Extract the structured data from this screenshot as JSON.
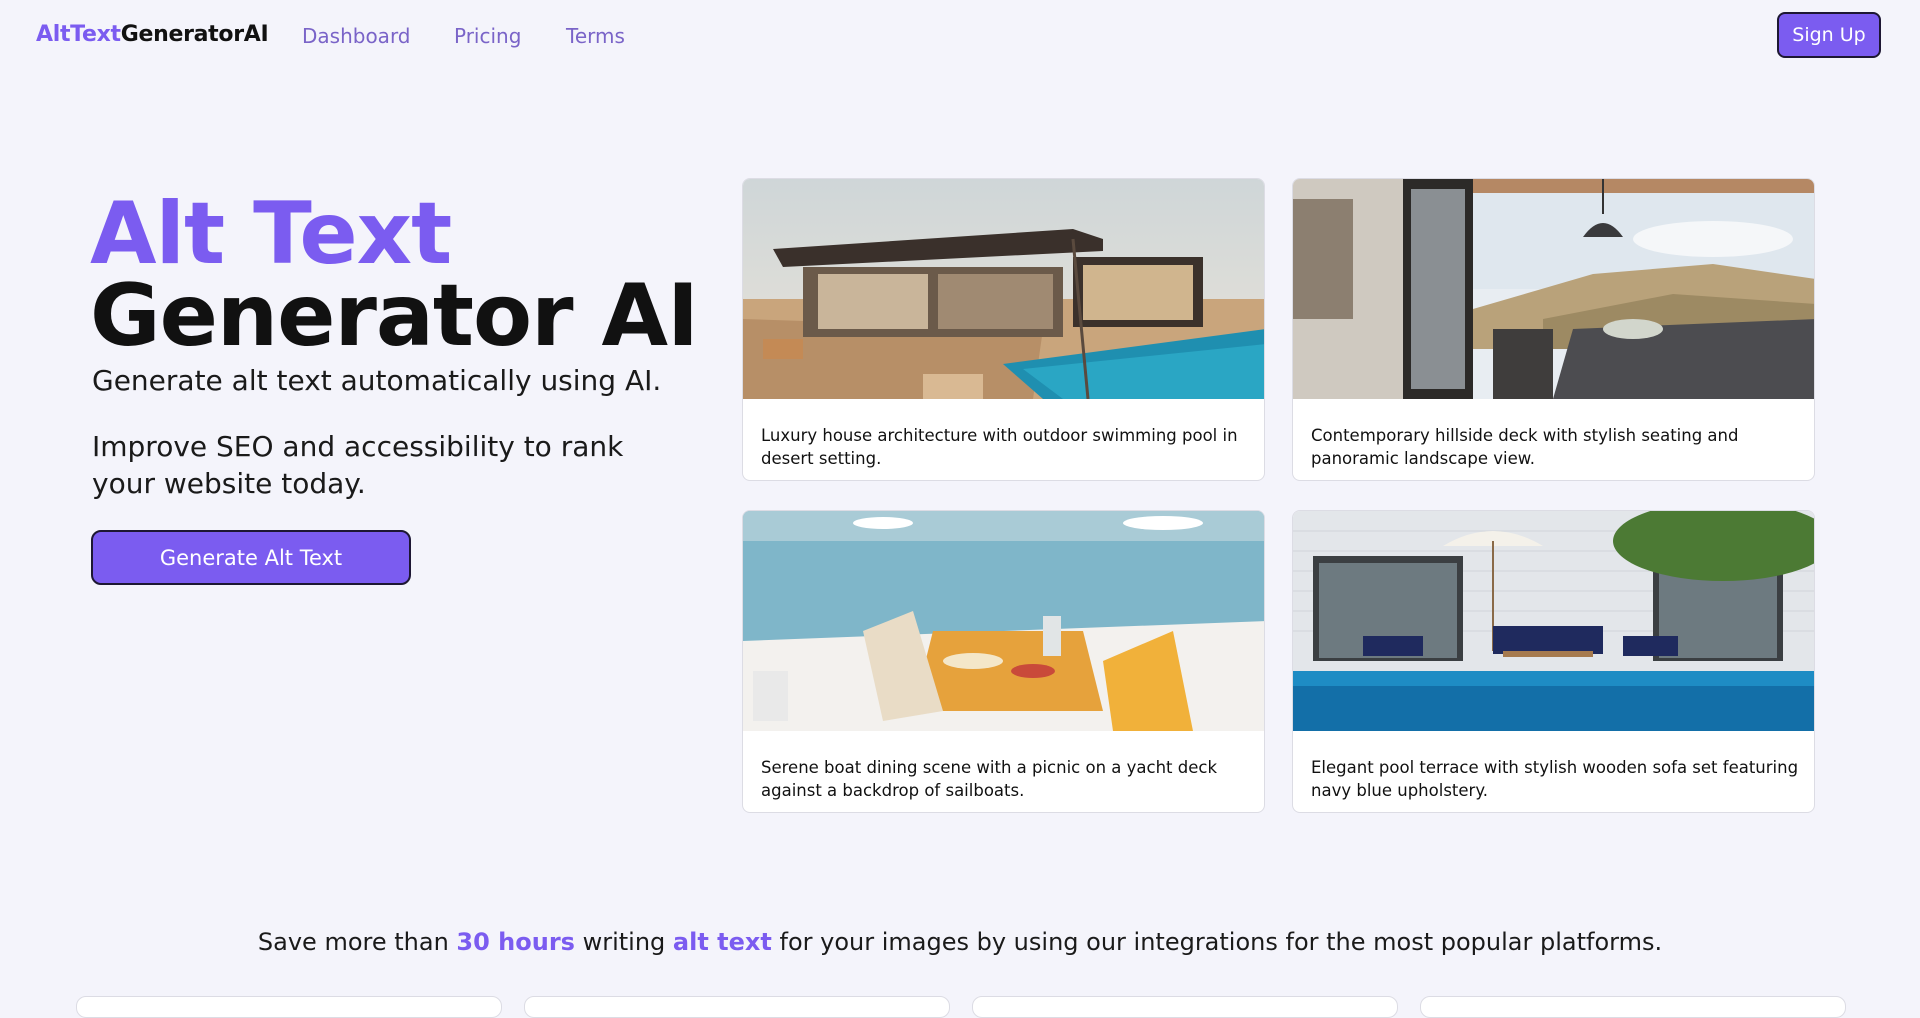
{
  "nav": {
    "logo_part1": "AltText",
    "logo_part2": "GeneratorAI",
    "links": [
      "Dashboard",
      "Pricing",
      "Terms"
    ],
    "signup_label": "Sign Up"
  },
  "hero": {
    "title_line1": "Alt Text",
    "title_line2": "Generator AI",
    "subtitle": "Generate alt text automatically using AI.",
    "body": "Improve SEO and accessibility to rank your website today.",
    "cta_label": "Generate Alt Text"
  },
  "cards": [
    {
      "caption": "Luxury house architecture with outdoor swimming pool in desert setting."
    },
    {
      "caption": "Contemporary hillside deck with stylish seating and panoramic landscape view."
    },
    {
      "caption": "Serene boat dining scene with a picnic on a yacht deck against a backdrop of sailboats."
    },
    {
      "caption": "Elegant pool terrace with stylish wooden sofa set featuring navy blue upholstery."
    }
  ],
  "savings": {
    "p1": "Save more than ",
    "hours": "30 hours",
    "p2": " writing ",
    "alt": "alt text",
    "p3": " for your images by using our integrations for the most popular platforms."
  },
  "colors": {
    "accent": "#7b5cf0",
    "background": "#f4f4fb",
    "nav_link": "#7a64c8"
  }
}
